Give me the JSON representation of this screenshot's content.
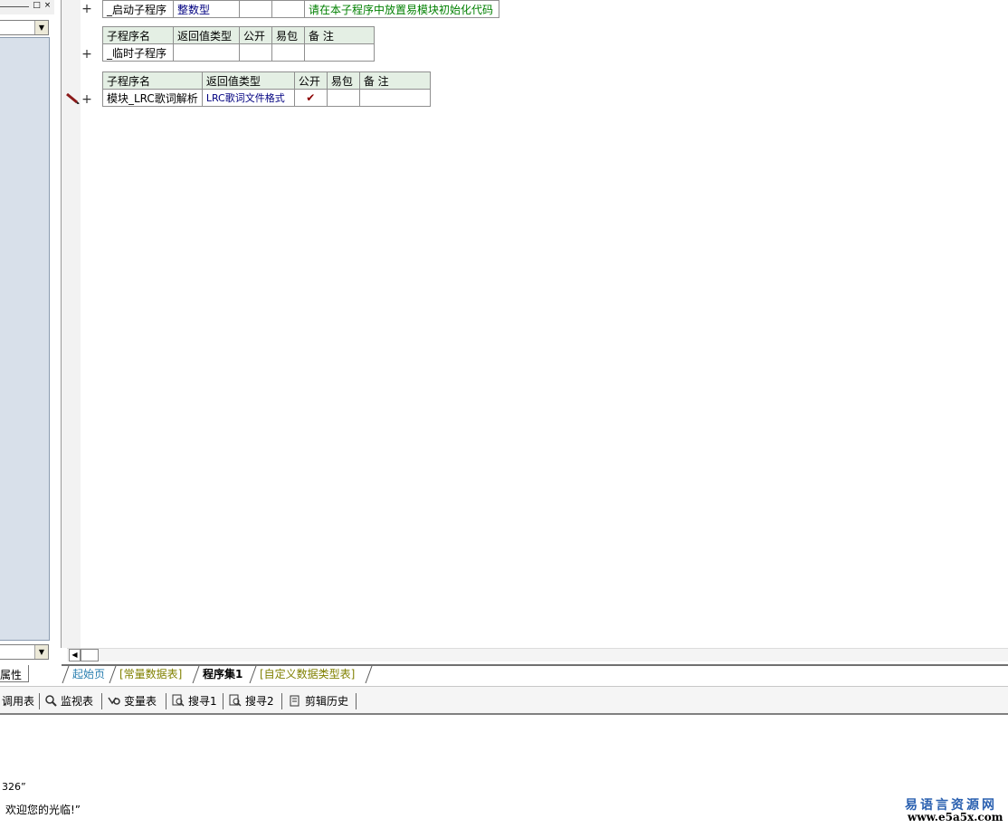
{
  "left_panel": {
    "window_buttons": [
      "□",
      "×"
    ],
    "bottom_tab_label": "属性"
  },
  "editor": {
    "proc_startup": {
      "name": "_启动子程序",
      "return_type": "整数型",
      "public": "",
      "easy_pack": "",
      "remark": "请在本子程序中放置易模块初始化代码"
    },
    "table_temp": {
      "headers": [
        "子程序名",
        "返回值类型",
        "公开",
        "易包",
        "备 注"
      ],
      "name": "_临时子程序",
      "return_type": "",
      "public": "",
      "easy_pack": "",
      "remark": ""
    },
    "table_lrc": {
      "headers": [
        "子程序名",
        "返回值类型",
        "公开",
        "易包",
        "备 注"
      ],
      "name": "模块_LRC歌词解析",
      "return_type": "LRC歌词文件格式",
      "public": "✔",
      "easy_pack": "",
      "remark": ""
    },
    "expand_glyph": "+"
  },
  "file_tabs": [
    "起始页",
    "[常量数据表]",
    "程序集1",
    "[自定义数据类型表]"
  ],
  "bottom_toolbar": [
    {
      "label": "调用表",
      "icon": "call-table-icon"
    },
    {
      "label": "监视表",
      "icon": "magnifier-icon"
    },
    {
      "label": "变量表",
      "icon": "variable-icon"
    },
    {
      "label": "搜寻1",
      "icon": "search-doc-icon"
    },
    {
      "label": "搜寻2",
      "icon": "search-doc-icon"
    },
    {
      "label": "剪辑历史",
      "icon": "clipboard-icon"
    }
  ],
  "output": {
    "line1": "326”",
    "line2": "欢迎您的光临!”"
  },
  "watermark": {
    "top": "易语言资源网",
    "bottom": "www.e5a5x.com"
  },
  "colors": {
    "header_bg": "#e4efe4",
    "type_blue": "#000080",
    "remark_green": "#008000",
    "left_list_bg": "#d8e0ea"
  }
}
